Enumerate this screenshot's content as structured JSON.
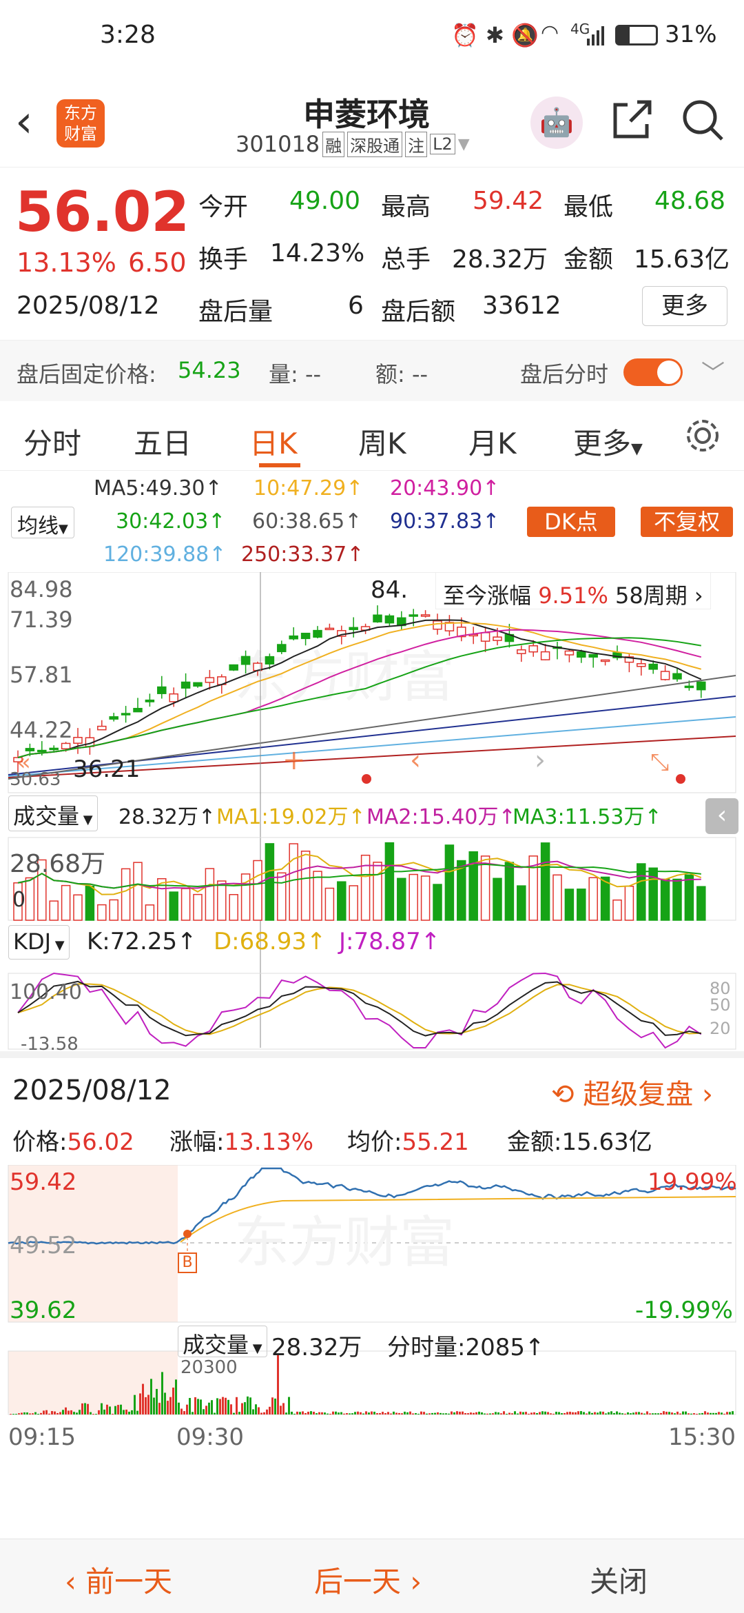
{
  "status": {
    "time": "3:28",
    "net": "4G",
    "battery": "31%"
  },
  "header": {
    "logo_line1": "东方",
    "logo_line2": "财富",
    "name": "申菱环境",
    "code": "301018",
    "tag1": "融",
    "tag2": "深股通",
    "tag3": "注",
    "tag4": "L2"
  },
  "quote": {
    "price": "56.02",
    "change_pct": "13.13%",
    "change": "6.50",
    "open_label": "今开",
    "open": "49.00",
    "high_label": "最高",
    "high": "59.42",
    "low_label": "最低",
    "low": "48.68",
    "turnover_label": "换手",
    "turnover": "14.23%",
    "vol_label": "总手",
    "vol": "28.32万",
    "amt_label": "金额",
    "amt": "15.63亿",
    "date": "2025/08/12",
    "after_vol_label": "盘后量",
    "after_vol": "6",
    "after_amt_label": "盘后额",
    "after_amt": "33612",
    "more": "更多",
    "fixed_label": "盘后固定价格:",
    "fixed_price": "54.23",
    "q_label": "量: --",
    "e_label": "额: --",
    "after_time_label": "盘后分时"
  },
  "periods": [
    "分时",
    "五日",
    "日K",
    "周K",
    "月K",
    "更多"
  ],
  "ma": {
    "ma5": "MA5:49.30↑",
    "ma10": "10:47.29↑",
    "ma20": "20:43.90↑",
    "ma30": "30:42.03↑",
    "ma60": "60:38.65↑",
    "ma90": "90:37.83↑",
    "ma120": "120:39.88↑",
    "ma250": "250:33.37↑",
    "selector": "均线",
    "dk": "DK点",
    "fq": "不复权"
  },
  "kchart": {
    "y1": "84.98",
    "y2": "71.39",
    "y3": "57.81",
    "y4": "44.22",
    "y5": "30.63",
    "low_mark": "36.21",
    "high_mark": "84.",
    "badge_label": "至今涨幅",
    "badge_val": "9.51%",
    "badge_period": "58周期"
  },
  "volume": {
    "selector": "成交量",
    "val": "28.32万↑",
    "ma1": "MA1:19.02万↑",
    "ma2": "MA2:15.40万↑",
    "ma3": "MA3:11.53万↑",
    "y_top": "28.68万",
    "y_zero": "0"
  },
  "kdj": {
    "selector": "KDJ",
    "k": "K:72.25↑",
    "d": "D:68.93↑",
    "j": "J:78.87↑",
    "y_top": "100.40",
    "y_bot": "-13.58",
    "r80": "80",
    "r50": "50",
    "r20": "20"
  },
  "detail": {
    "date": "2025/08/12",
    "replay": "超级复盘",
    "price_label": "价格:",
    "price": "56.02",
    "pct_label": "涨幅:",
    "pct": "13.13%",
    "avg_label": "均价:",
    "avg": "55.21",
    "amt_label": "金额:",
    "amt": "15.63亿",
    "y_hi": "59.42",
    "y_mid": "49.52",
    "y_lo": "39.62",
    "pct_hi": "19.99%",
    "pct_lo": "-19.99%",
    "b_mark": "B",
    "vol_selector": "成交量",
    "vol": "28.32万",
    "tick_vol": "分时量:2085↑",
    "vol_peak": "20300",
    "t1": "09:15",
    "t2": "09:30",
    "t3": "15:30"
  },
  "footer": {
    "prev": "前一天",
    "next": "后一天",
    "close": "关闭"
  },
  "colors": {
    "up": "#e0332c",
    "down": "#16a316",
    "accent": "#e85c1a"
  }
}
